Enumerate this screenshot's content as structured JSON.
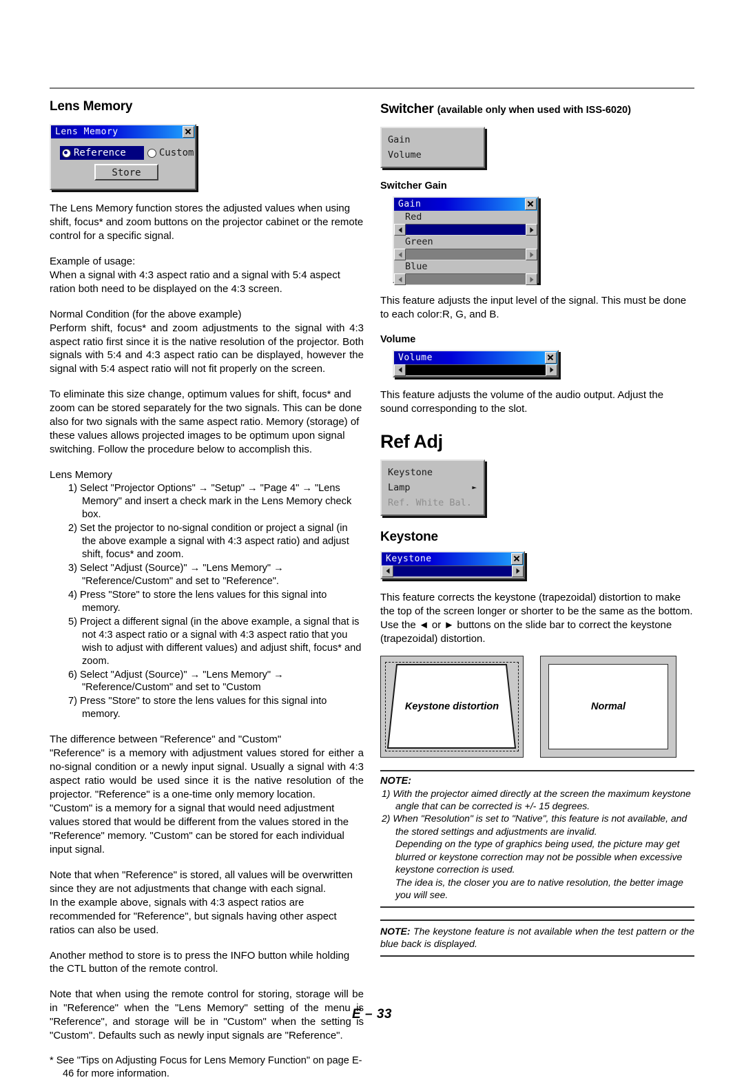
{
  "page": {
    "footer": "E – 33"
  },
  "left": {
    "heading": "Lens Memory",
    "dialog": {
      "title": "Lens Memory",
      "close_icon": "close-icon",
      "option_selected": "Reference",
      "option_unselected": "Custom",
      "store_button": "Store"
    },
    "p1": "The Lens Memory function stores the adjusted values when using shift, focus* and zoom buttons on the projector cabinet or the remote control for a specific signal.",
    "p2_line1": "Example of usage:",
    "p2_line2": "When a signal with 4:3 aspect ratio and a signal with 5:4 aspect ration both need to be displayed on the 4:3 screen.",
    "p3_line1": "Normal Condition (for the above example)",
    "p3_line2": "Perform shift, focus* and zoom adjustments to the signal with 4:3 aspect ratio first since it is the native resolution of the projector. Both signals with 5:4 and 4:3 aspect ratio can be displayed, however the signal with 5:4 aspect ratio will not fit properly on the screen.",
    "p4": "To eliminate this size change, optimum values for shift, focus* and zoom can be stored separately for the two signals. This can be done also for two signals with the same aspect ratio. Memory (storage) of these values allows projected images to be optimum upon signal switching. Follow the procedure below to accomplish this.",
    "list_title": "Lens Memory",
    "steps": [
      "1) Select \"Projector Options\" → \"Setup\" → \"Page 4\" → \"Lens Memory\" and insert a check mark in the Lens Memory check box.",
      "2) Set the projector to no-signal condition or project a signal (in the above example a signal with 4:3 aspect ratio) and adjust shift, focus* and zoom.",
      "3) Select \"Adjust (Source)\" → \"Lens Memory\" → \"Reference/Custom\" and set to \"Reference\".",
      "4) Press \"Store\" to store the lens values for this signal into memory.",
      "5) Project a different signal (in the above example, a signal that is not 4:3 aspect ratio or a signal with 4:3 aspect ratio that you wish to adjust with different values) and adjust shift, focus* and zoom.",
      "6) Select \"Adjust (Source)\" → \"Lens Memory\" → \"Reference/Custom\" and set to \"Custom",
      "7) Press \"Store\" to store the lens values for this signal into memory."
    ],
    "p5_line1": "The difference between \"Reference\" and \"Custom\"",
    "p5_line2": "\"Reference\" is a memory with adjustment values stored for either a no-signal condition or a newly input signal. Usually a signal with 4:3 aspect ratio would be used since it is the native resolution of the projector. \"Reference\" is a one-time only memory location.",
    "p5_line3": "\"Custom\" is a memory for a signal that would need adjustment values stored that would be different from the values stored in the \"Reference\" memory. \"Custom\" can be stored for each individual input signal.",
    "p6_line1": "Note that when \"Reference\" is stored, all values will be overwritten since they are not adjustments that change with each signal.",
    "p6_line2": "In the example above, signals with 4:3 aspect ratios are recommended for \"Reference\", but signals having other aspect ratios can also be used.",
    "p7": "Another method to store is to press the INFO button while holding the CTL button of the remote control.",
    "p8": "Note that when using the remote control for storing, storage will be in \"Reference\" when the \"Lens Memory\" setting of the menu is \"Reference\", and storage will be in \"Custom\" when the setting is \"Custom\". Defaults such as newly input signals are \"Reference\".",
    "star_note": "*  See \"Tips on Adjusting Focus for Lens Memory Function\" on page E-46 for more information."
  },
  "right": {
    "switcher_heading": "Switcher",
    "switcher_heading_sub": "(available only when used with ISS-6020)",
    "switcher_menu": [
      "Gain",
      "Volume"
    ],
    "gain_subhead": "Switcher Gain",
    "gain_dialog": {
      "title": "Gain",
      "close_icon": "close-icon",
      "sliders": [
        {
          "label": "Red",
          "state": "active"
        },
        {
          "label": "Green",
          "state": "normal"
        },
        {
          "label": "Blue",
          "state": "normal"
        }
      ]
    },
    "gain_text": "This feature adjusts the input level of the signal. This must be done to each color:R, G, and B.",
    "volume_subhead": "Volume",
    "volume_dialog": {
      "title": "Volume",
      "close_icon": "close-icon"
    },
    "volume_text": "This feature adjusts the volume of the audio output. Adjust the sound corresponding to the slot.",
    "refadj_heading": "Ref Adj",
    "refadj_menu": [
      {
        "label": "Keystone",
        "dim": false,
        "arrow": ""
      },
      {
        "label": "Lamp",
        "dim": false,
        "arrow": "►"
      },
      {
        "label": "Ref. White Bal.",
        "dim": true,
        "arrow": ""
      }
    ],
    "keystone_subhead": "Keystone",
    "keystone_dialog": {
      "title": "Keystone",
      "close_icon": "close-icon"
    },
    "keystone_text": "This feature corrects the keystone (trapezoidal) distortion to make the top of the screen longer or shorter to be the same as the bottom. Use the ◄ or ► buttons on the slide bar to correct the keystone (trapezoidal) distortion.",
    "fig_distortion_caption": "Keystone distortion",
    "fig_normal_caption": "Normal",
    "note1_title": "NOTE:",
    "note1_items": [
      "1) With the projector aimed directly at the screen the maximum keystone angle that can be corrected is +/- 15 degrees.",
      "2) When \"Resolution\" is set to \"Native\", this feature is not available, and the stored settings and adjustments are invalid."
    ],
    "note1_cont1": "Depending on the type of graphics being used, the picture may get blurred or keystone correction may not be possible when excessive keystone correction is used.",
    "note1_cont2": "The idea is, the closer you are to native resolution, the better image you will see.",
    "note2_label": "NOTE:",
    "note2_text": " The keystone feature is not available when the test pattern or the blue back is displayed."
  }
}
